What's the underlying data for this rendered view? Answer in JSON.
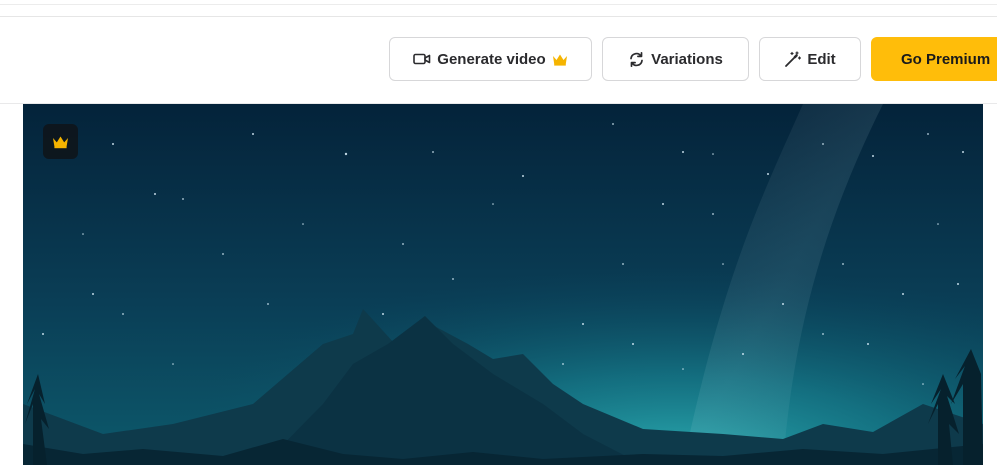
{
  "toolbar": {
    "generate_video": {
      "label": "Generate video",
      "icon": "video-camera-icon",
      "badge_icon": "crown-icon"
    },
    "variations": {
      "label": "Variations",
      "icon": "refresh-icon"
    },
    "edit": {
      "label": "Edit",
      "icon": "magic-wand-icon"
    },
    "premium": {
      "label": "Go Premium"
    }
  },
  "image": {
    "badge_icon": "crown-icon"
  },
  "colors": {
    "accent": "#ffbd0a",
    "crown": "#f5b400",
    "border": "#d7d7d9",
    "text": "#2b2b2e"
  }
}
